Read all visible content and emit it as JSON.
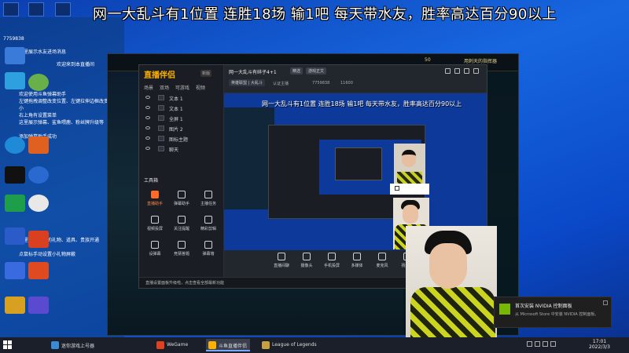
{
  "overlay_banner": "网一大乱斗有1位置   连胜18场  输1吧    每天带水友，胜率高达百分90以上",
  "chat": {
    "room_id": "7759838",
    "lines": [
      "这里展示水友进场消息",
      "欢迎来到本直播间",
      "欢迎使用斗鱼弹幕助手",
      "左键拖拽调整改变位置、左键拉伸边框改变大小",
      "右上角有设置菜单",
      "这里展示弹幕、鲨鱼喂鹿、粉丝牌升级等",
      "添加弹幕助手成功",
      "这里展示收到的礼物、道具、贵族开通",
      "点鼠标手动设置小礼物屏蔽"
    ]
  },
  "game": {
    "coins": "50",
    "name": "用刺天的指挥器"
  },
  "app": {
    "logo": "直播伴侣",
    "version": "新版",
    "scene_tabs": [
      "场景",
      "双场",
      "可游戏",
      "视频"
    ],
    "layers": [
      "文本 1",
      "文本 1",
      "全屏 1",
      "图片 2",
      "图标主题",
      "聊天"
    ],
    "tools_title": "工具箱",
    "tools": [
      {
        "label": "直播助手",
        "active": true
      },
      {
        "label": "弹幕助手",
        "active": false
      },
      {
        "label": "主播任务",
        "active": false
      },
      {
        "label": "视频投屏",
        "active": false
      },
      {
        "label": "关注提醒",
        "active": false
      },
      {
        "label": "精彩剪辑",
        "active": false
      },
      {
        "label": "设弹幕",
        "active": false
      },
      {
        "label": "竞猜答题",
        "active": false
      },
      {
        "label": "弹幕墙",
        "active": false
      }
    ],
    "room_title": "网一大乱斗有碎子4+1",
    "room_tag": "精选",
    "room_tag2": "游戏正文",
    "room_category": "英雄联盟 | 大乱斗",
    "room_sub": "认证主播",
    "room_id": "7759838",
    "room_number": "11600",
    "preview_banner": "网一大乱斗有1位置  连胜18场  输1吧    每天带水友，胜率高达百分90以上",
    "controls": [
      "直播间聊",
      "摄像头",
      "手机投屏",
      "多媒体",
      "麦克风",
      "扬声器"
    ],
    "bottom_msg": "直播设置面板升级啦，点击查看全部最新功能"
  },
  "notification": {
    "title": "首次安装 NVIDIA 控制面板",
    "body": "从 Microsoft Store 中安装 NVIDIA 控制面板。"
  },
  "taskbar": {
    "items": [
      "迷你游戏上号器",
      "WeGame",
      "斗鱼直播伴侣",
      "League of Legends"
    ],
    "time": "17:01",
    "date": "2022/3/3"
  }
}
